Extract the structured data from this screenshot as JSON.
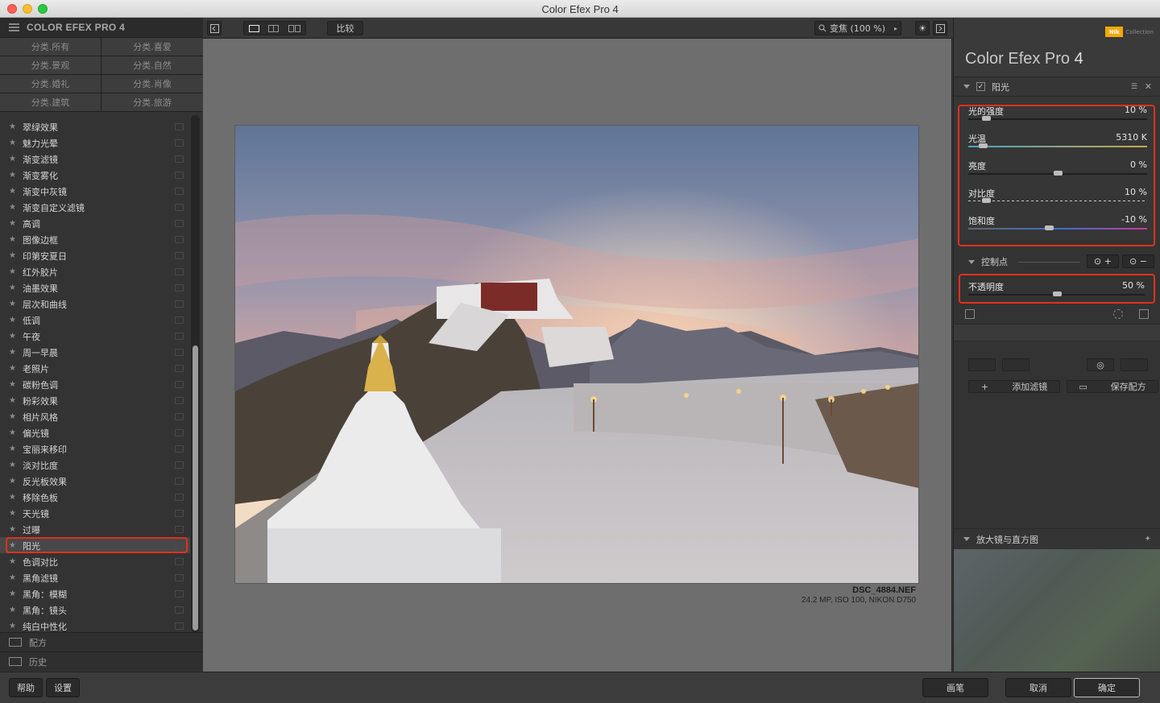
{
  "window": {
    "title": "Color Efex Pro 4"
  },
  "left": {
    "header": "COLOR EFEX PRO 4",
    "categories": [
      "分类.所有",
      "分类.喜爱",
      "分类.景观",
      "分类.自然",
      "分类.婚礼",
      "分类.肖像",
      "分类.建筑",
      "分类.旅游"
    ],
    "filters": [
      "翠绿效果",
      "魅力光晕",
      "渐变滤镜",
      "渐变雾化",
      "渐变中灰镜",
      "渐变自定义滤镜",
      "高调",
      "图像边框",
      "印第安夏日",
      "红外胶片",
      "油墨效果",
      "层次和曲线",
      "低调",
      "午夜",
      "周一早晨",
      "老照片",
      "碳粉色调",
      "粉彩效果",
      "相片风格",
      "偏光镜",
      "宝丽来移印",
      "淡对比度",
      "反光板效果",
      "移除色板",
      "天光镜",
      "过曝",
      "阳光",
      "色调对比",
      "黑角滤镜",
      "黑角：模糊",
      "黑角：镜头",
      "纯白中性化"
    ],
    "selected_filter": "阳光",
    "recipes": "配方",
    "history": "历史"
  },
  "toolbar": {
    "compare": "比较",
    "zoom": "变焦 (100 %)"
  },
  "image": {
    "filename": "DSC_4884.NEF",
    "meta": "24.2 MP, ISO 100, NIKON D750"
  },
  "right": {
    "logo_text": "Collection",
    "logo_badge": "Nik",
    "product": "Color Efex Pro",
    "version": "4",
    "filter_name": "阳光",
    "sliders": [
      {
        "label": "光的强度",
        "value": "10 %",
        "pos": 0.1
      },
      {
        "label": "光温",
        "value": "5310 K",
        "pos": 0.08
      },
      {
        "label": "亮度",
        "value": "0 %",
        "pos": 0.5
      },
      {
        "label": "对比度",
        "value": "10 %",
        "pos": 0.1
      },
      {
        "label": "饱和度",
        "value": "-10 %",
        "pos": 0.45
      }
    ],
    "control_points": "控制点",
    "opacity": {
      "label": "不透明度",
      "value": "50 %",
      "pos": 0.5
    },
    "add_filter": "添加滤镜",
    "save_recipe": "保存配方",
    "loupe": "放大镜与直方图"
  },
  "bottom": {
    "help": "帮助",
    "settings": "设置",
    "brush": "画笔",
    "cancel": "取消",
    "ok": "确定"
  },
  "colors": {
    "highlight": "#e0311c",
    "accent": "#f2a900"
  }
}
